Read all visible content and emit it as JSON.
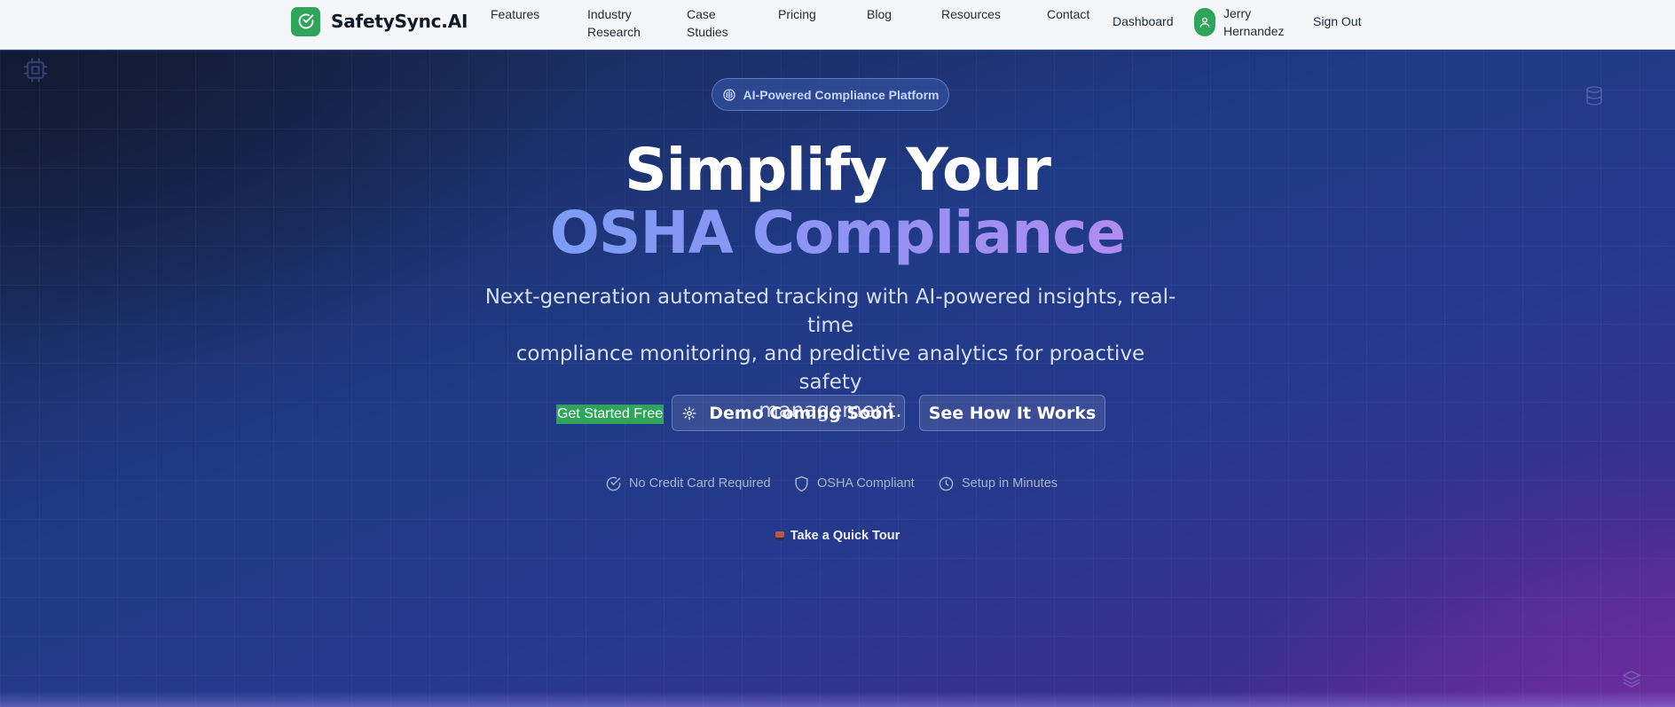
{
  "brand": {
    "name": "SafetySync.AI"
  },
  "nav": {
    "links": [
      {
        "line1": "Features",
        "line2": ""
      },
      {
        "line1": "Industry",
        "line2": "Research"
      },
      {
        "line1": "Case",
        "line2": "Studies"
      },
      {
        "line1": "Pricing",
        "line2": ""
      },
      {
        "line1": "Blog",
        "line2": ""
      },
      {
        "line1": "Resources",
        "line2": ""
      },
      {
        "line1": "Contact",
        "line2": ""
      }
    ],
    "dashboard": "Dashboard",
    "user": {
      "first": "Jerry",
      "last": "Hernandez"
    },
    "sign_out": "Sign Out"
  },
  "hero": {
    "badge": "AI-Powered Compliance Platform",
    "headline_line1": "Simplify Your",
    "headline_line2": "OSHA Compliance",
    "subtitle_lines": [
      "Next-generation automated tracking with AI-powered insights, real-time",
      "compliance monitoring, and predictive analytics for proactive safety",
      "management."
    ],
    "cta": {
      "get_started": "Get Started Free",
      "demo": "Demo Coming Soon",
      "how_it_works": "See How It Works"
    },
    "trust": [
      {
        "icon": "check-circle-icon",
        "label": "No Credit Card Required"
      },
      {
        "icon": "shield-icon",
        "label": "OSHA Compliant"
      },
      {
        "icon": "clock-icon",
        "label": "Setup in Minutes"
      }
    ],
    "tour": "Take a Quick Tour"
  },
  "colors": {
    "brand_green": "#2fa55b",
    "nav_bg": "#f5f6f8",
    "hero_blue": "#1f3a86",
    "hero_purple": "#5a2a94",
    "headline_gradient_start": "#7c9df5",
    "headline_gradient_end": "#b08cf1"
  }
}
